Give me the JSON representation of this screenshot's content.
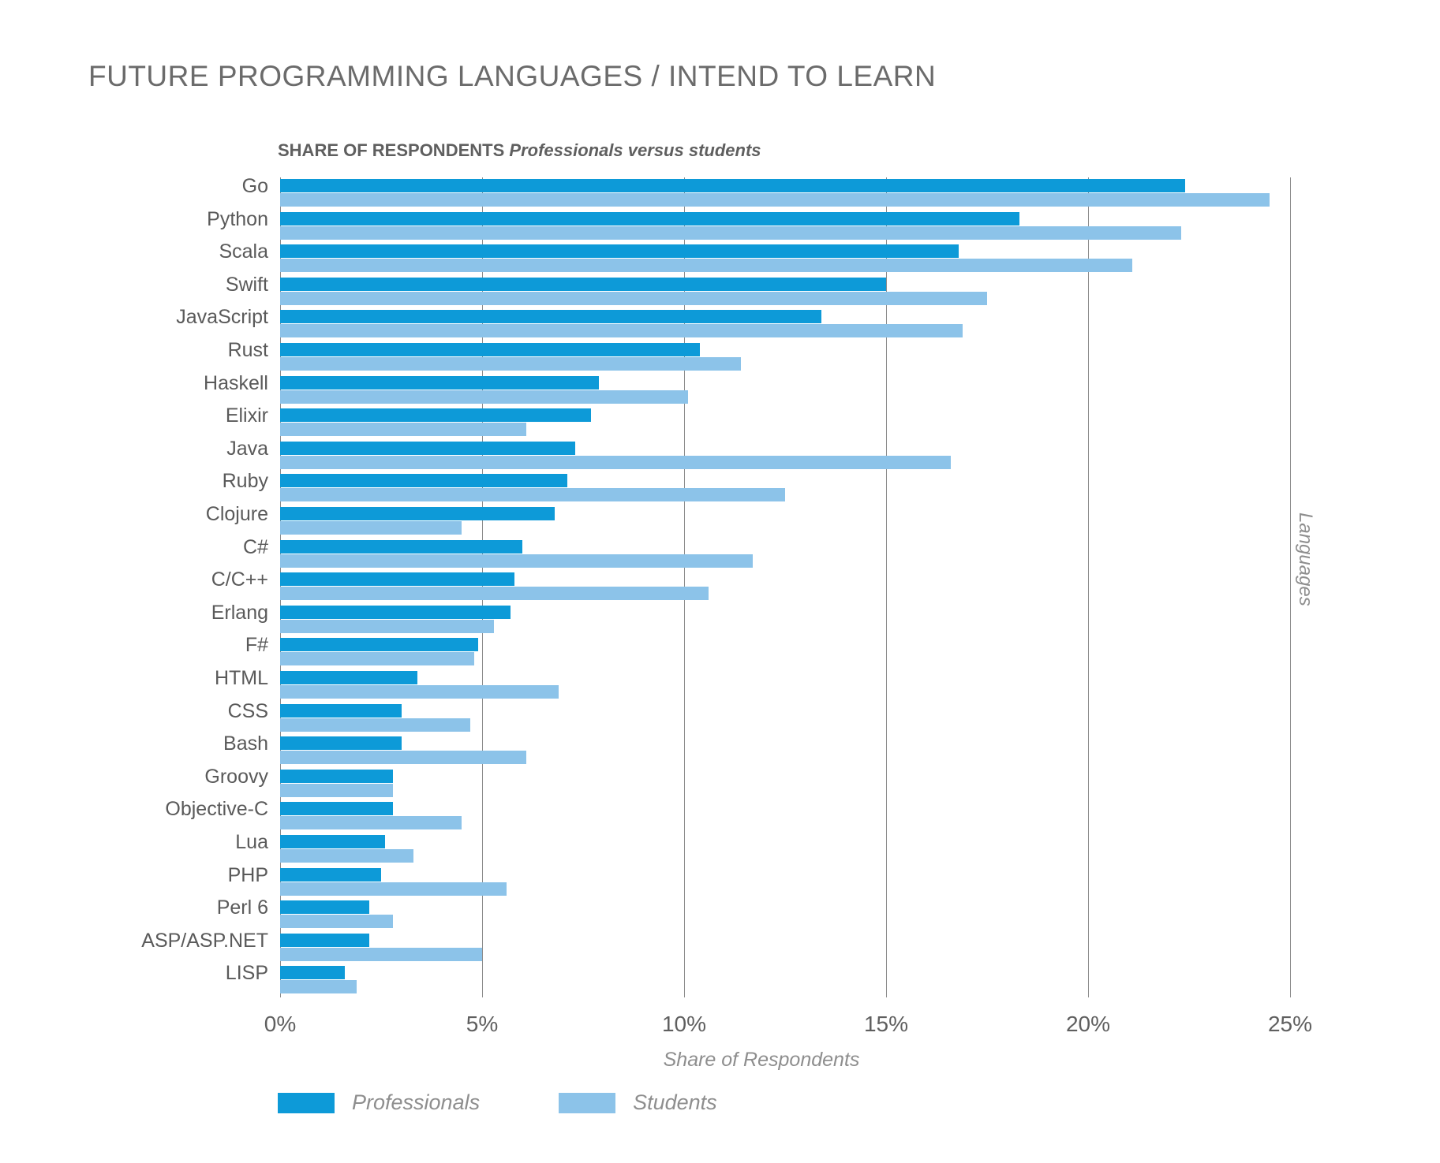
{
  "title": "FUTURE PROGRAMMING LANGUAGES / INTEND TO LEARN",
  "subtitle": {
    "bold": "SHARE OF RESPONDENTS",
    "italic": "Professionals versus students"
  },
  "colors": {
    "professionals": "#0d9ad8",
    "students": "#8cc3e9",
    "text": "#5a5a5a",
    "axis_text": "#8e8e8e",
    "gridline": "#8c8c8c"
  },
  "legend": {
    "position": "bottom-left",
    "items": [
      {
        "label": "Professionals",
        "color": "#0d9ad8"
      },
      {
        "label": "Students",
        "color": "#8cc3e9"
      }
    ]
  },
  "chart_data": {
    "type": "bar",
    "orientation": "horizontal",
    "title": "FUTURE PROGRAMMING LANGUAGES / INTEND TO LEARN",
    "subtitle": "SHARE OF RESPONDENTS Professionals versus students",
    "xlabel": "Share of Respondents",
    "ylabel": "Languages",
    "xlim": [
      0,
      25
    ],
    "xticks": [
      0,
      5,
      10,
      15,
      20,
      25
    ],
    "xtick_labels": [
      "0%",
      "5%",
      "10%",
      "15%",
      "20%",
      "25%"
    ],
    "grid": true,
    "grid_axis": "x",
    "legend_position": "bottom-left",
    "categories": [
      "Go",
      "Python",
      "Scala",
      "Swift",
      "JavaScript",
      "Rust",
      "Haskell",
      "Elixir",
      "Java",
      "Ruby",
      "Clojure",
      "C#",
      "C/C++",
      "Erlang",
      "F#",
      "HTML",
      "CSS",
      "Bash",
      "Groovy",
      "Objective-C",
      "Lua",
      "PHP",
      "Perl 6",
      "ASP/ASP.NET",
      "LISP"
    ],
    "series": [
      {
        "name": "Professionals",
        "color": "#0d9ad8",
        "values": [
          22.4,
          18.3,
          16.8,
          15.0,
          13.4,
          10.4,
          7.9,
          7.7,
          7.3,
          7.1,
          6.8,
          6.0,
          5.8,
          5.7,
          4.9,
          3.4,
          3.0,
          3.0,
          2.8,
          2.8,
          2.6,
          2.5,
          2.2,
          2.2,
          1.6
        ]
      },
      {
        "name": "Students",
        "color": "#8cc3e9",
        "values": [
          24.5,
          22.3,
          21.1,
          17.5,
          16.9,
          11.4,
          10.1,
          6.1,
          16.6,
          12.5,
          4.5,
          11.7,
          10.6,
          5.3,
          4.8,
          6.9,
          4.7,
          6.1,
          2.8,
          4.5,
          3.3,
          5.6,
          2.8,
          5.0,
          1.9
        ]
      }
    ]
  }
}
